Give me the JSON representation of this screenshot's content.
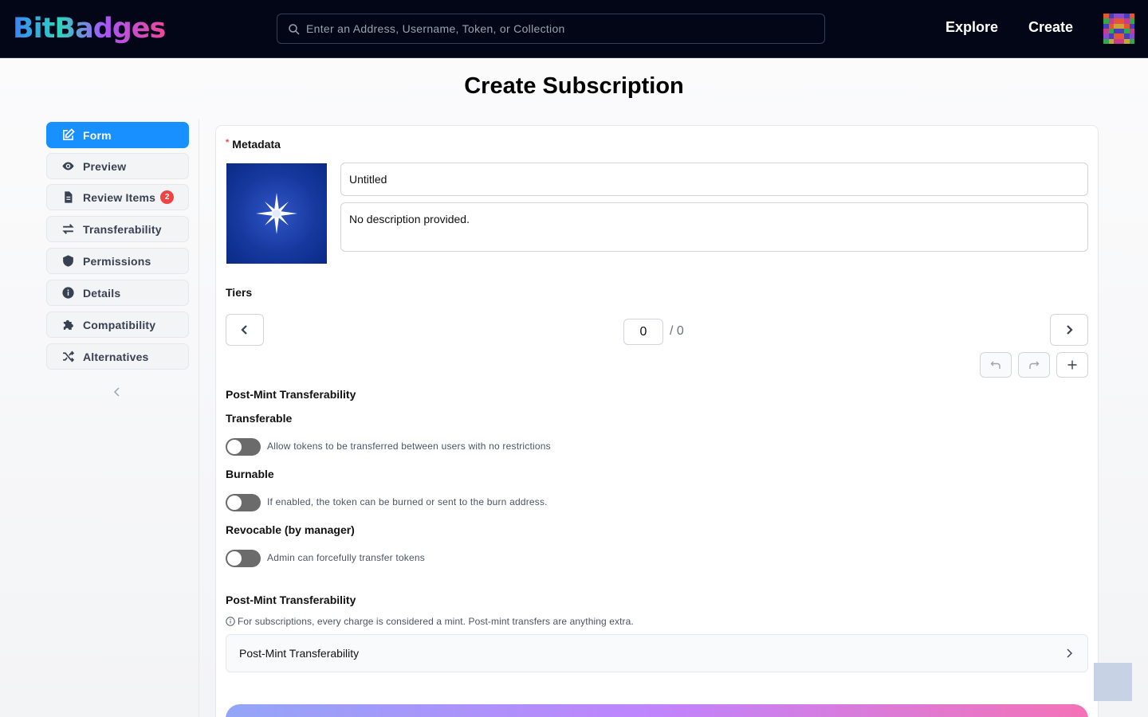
{
  "header": {
    "logo": "BitBadges",
    "search_placeholder": "Enter an Address, Username, Token, or Collection",
    "nav": {
      "explore": "Explore",
      "create": "Create"
    },
    "avatar_colors": [
      "#e2572f",
      "#4a3db8",
      "#8b4ad0",
      "#8b4ad0",
      "#4a3db8",
      "#e2572f",
      "#2fa84f",
      "#c83c8e",
      "#e2572f",
      "#e2572f",
      "#c83c8e",
      "#2fa84f",
      "#4a3db8",
      "#e2572f",
      "#c8a53c",
      "#c8a53c",
      "#e2572f",
      "#4a3db8",
      "#c83c8e",
      "#2fa84f",
      "#4a3db8",
      "#4a3db8",
      "#2fa84f",
      "#c83c8e",
      "#8b4ad0",
      "#4a3db8",
      "#e2572f",
      "#e2572f",
      "#4a3db8",
      "#8b4ad0",
      "#2fa84f",
      "#c8a53c",
      "#c83c8e",
      "#c83c8e",
      "#c8a53c",
      "#2fa84f"
    ]
  },
  "page": {
    "title": "Create Subscription"
  },
  "sidebar": {
    "items": [
      {
        "label": "Form",
        "icon": "edit-icon",
        "active": true
      },
      {
        "label": "Preview",
        "icon": "eye-icon"
      },
      {
        "label": "Review Items",
        "icon": "document-icon",
        "badge": "2"
      },
      {
        "label": "Transferability",
        "icon": "arrows-exchange-icon"
      },
      {
        "label": "Permissions",
        "icon": "shield-icon"
      },
      {
        "label": "Details",
        "icon": "info-circle-icon"
      },
      {
        "label": "Compatibility",
        "icon": "puzzle-icon"
      },
      {
        "label": "Alternatives",
        "icon": "shuffle-icon"
      }
    ]
  },
  "form": {
    "metadata_label": "Metadata",
    "required_mark": "*",
    "name_value": "Untitled",
    "description_value": "No description provided.",
    "tiers_label": "Tiers",
    "tier_current": "0",
    "tier_total": "/ 0",
    "post_mint_heading": "Post-Mint Transferability",
    "transferable": {
      "label": "Transferable",
      "desc": "Allow tokens to be transferred between users with no restrictions",
      "on": false
    },
    "burnable": {
      "label": "Burnable",
      "desc": "If enabled, the token can be burned or sent to the burn address.",
      "on": false
    },
    "revocable": {
      "label": "Revocable (by manager)",
      "desc": "Admin can forcefully transfer tokens",
      "on": false
    },
    "post_mint_heading_2": "Post-Mint Transferability",
    "info_note": "For subscriptions, every charge is considered a mint. Post-mint transfers are anything extra.",
    "collapse_title": "Post-Mint Transferability"
  }
}
